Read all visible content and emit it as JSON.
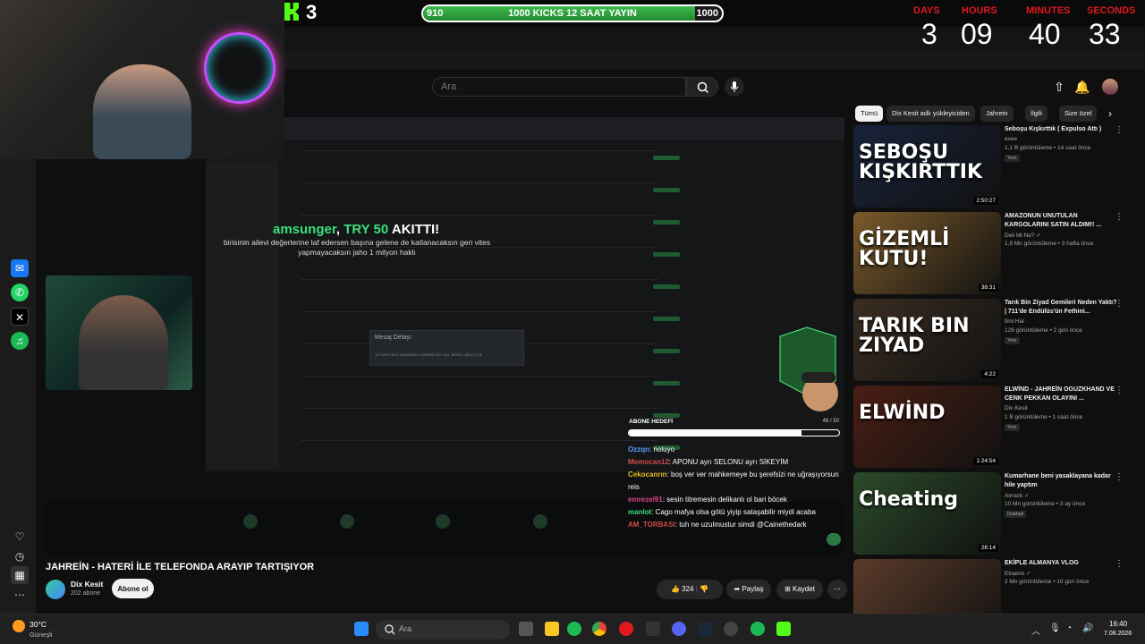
{
  "stream": {
    "kick_count": "3",
    "goal_min": "910",
    "goal_label": "1000 KICKS 12 SAAT YAYIN",
    "goal_max": "1000",
    "goal_progress": 0.91,
    "countdown": {
      "labels": [
        "DAYS",
        "HOURS",
        "MINUTES",
        "SECONDS"
      ],
      "values": [
        "3",
        "09",
        "40",
        "33"
      ]
    },
    "donation": {
      "user": "amsunger",
      "sep": ", ",
      "amount": "TRY 50",
      "suffix": " AKITTI!"
    },
    "donation_msg": "birisinin ailevi değerlerine laf edersen başına gelene de katlanacaksın geri vites yapmayacaksın jaho 1 milyon haklı",
    "modal": {
      "title": "Mesaj Detayı",
      "body": "10 sene önce avlattıkları reddettik biz onu. Benim oğlum yok"
    },
    "sub_goal": {
      "label": "ABONE HEDEFİ",
      "count": "46 / 50",
      "progress": 0.82
    },
    "chat": [
      {
        "user": "Ozzqn",
        "color": "#59a3ff",
        "text": ": noluyo"
      },
      {
        "user": "Memocan12",
        "color": "#d14b4b",
        "text": ": APONU ayrı SELONU ayrı SİKEYİM"
      },
      {
        "user": "Cekocanrın",
        "color": "#e6c12a",
        "text": ": boş ver ver mahkemeye bu şerefsizi ne uğraşıyorsun reis"
      },
      {
        "user": "emrezel91",
        "color": "#d64682",
        "text": ": sesin titremesin delikanlı ol bari böcek"
      },
      {
        "user": "manlot",
        "color": "#3ce07a",
        "text": ": Cago mafya olsa götü yiyip sataşabilir miydi acaba"
      },
      {
        "user": "AM_TORBASI",
        "color": "#d14b4b",
        "text": ": tuh ne uzulmustur simdi @Cainethedark"
      }
    ]
  },
  "youtube": {
    "search_placeholder": "Ara",
    "video_title": "JAHREİN - HATERİ İLE TELEFONDA ARAYIP TARTIŞIYOR",
    "channel_name": "Dix Kesit",
    "channel_subs": "202 abone",
    "subscribe_label": "Abone ol",
    "likes": "324",
    "share_label": "Paylaş",
    "save_label": "Kaydet",
    "chips": [
      "Tümü",
      "Dix Kesit adlı yükleyiciden",
      "Jahrein",
      "İlgili",
      "Size özel"
    ],
    "recommendations": [
      {
        "title": "Seboşu Kışkırttık ( Expulso Attı )",
        "channel": "exee",
        "meta": "1,1 B görüntüleme • 14 saat önce",
        "badge": "Yeni",
        "duration": "2:50:27",
        "thumb_text": "SEBOŞU KIŞKIRTTIK",
        "thumb_color": "#18223a"
      },
      {
        "title": "AMAZONUN UNUTULAN KARGOLARINI SATIN ALDIM!! ...",
        "channel": "Deli Mi Ne? ✓",
        "meta": "1,9 Mn görüntüleme • 3 hafta önce",
        "badge": "",
        "duration": "38:31",
        "thumb_text": "GİZEMLİ KUTU!",
        "thumb_color": "#7b5a2a"
      },
      {
        "title": "Tarık Bin Ziyad Gemileri Neden Yaktı? | 711'de Endülüs'ün Fethini...",
        "channel": "İlmi Hal",
        "meta": "126 görüntüleme • 2 gün önce",
        "badge": "Yeni",
        "duration": "4:22",
        "thumb_text": "TARIK BIN ZIYAD",
        "thumb_color": "#3a2d22"
      },
      {
        "title": "ELWİND - JAHREİN OGUZKHAND VE CENK PEKKAN OLAYINI ...",
        "channel": "Dix Kesit",
        "meta": "1 B görüntüleme • 1 saat önce",
        "badge": "Yeni",
        "duration": "1:24:54",
        "thumb_text": "ELWİND",
        "thumb_color": "#4a1e14"
      },
      {
        "title": "Kumarhane beni yasaklayana kadar hile yaptım",
        "channel": "Airrack ✓",
        "meta": "10 Mn görüntüleme • 3 ay önce",
        "badge": "Dublajlı",
        "duration": "28:14",
        "thumb_text": "Cheating",
        "thumb_color": "#2b4a2a"
      },
      {
        "title": "EKİPLE ALMANYA VLOG",
        "channel": "Elraenn ✓",
        "meta": "2 Mn görüntüleme • 10 gün önce",
        "badge": "",
        "duration": "",
        "thumb_text": "",
        "thumb_color": "#5b3b2a"
      }
    ]
  },
  "taskbar": {
    "weather_temp": "30°C",
    "weather_desc": "Güneşli",
    "search_label": "Ara",
    "time": "16:40",
    "date": "7.08.2026"
  }
}
